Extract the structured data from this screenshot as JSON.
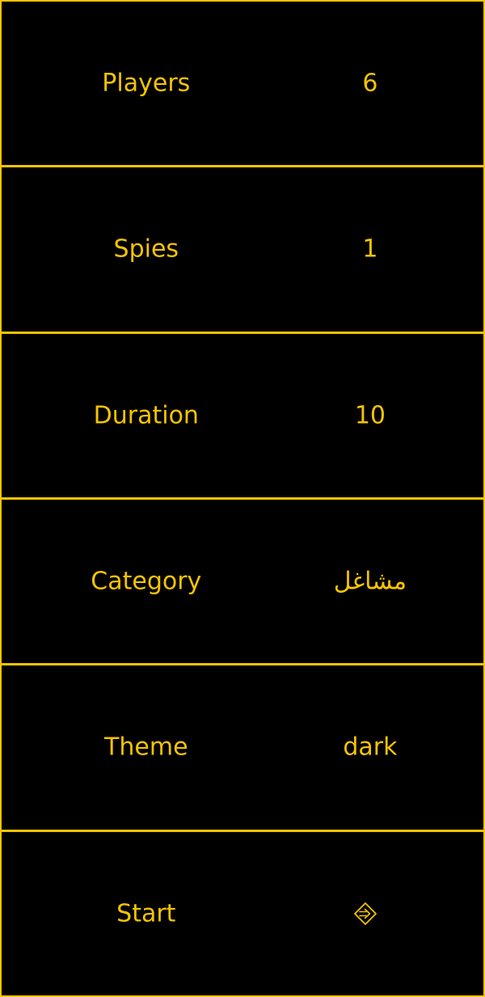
{
  "colors": {
    "background": "#000000",
    "accent": "#f5c400"
  },
  "settings": [
    {
      "key": "players",
      "label": "Players",
      "value": "6"
    },
    {
      "key": "spies",
      "label": "Spies",
      "value": "1"
    },
    {
      "key": "duration",
      "label": "Duration",
      "value": "10"
    },
    {
      "key": "category",
      "label": "Category",
      "value": "مشاغل"
    },
    {
      "key": "theme",
      "label": "Theme",
      "value": "dark"
    }
  ],
  "start": {
    "label": "Start",
    "icon": "enter-arrow-icon"
  }
}
